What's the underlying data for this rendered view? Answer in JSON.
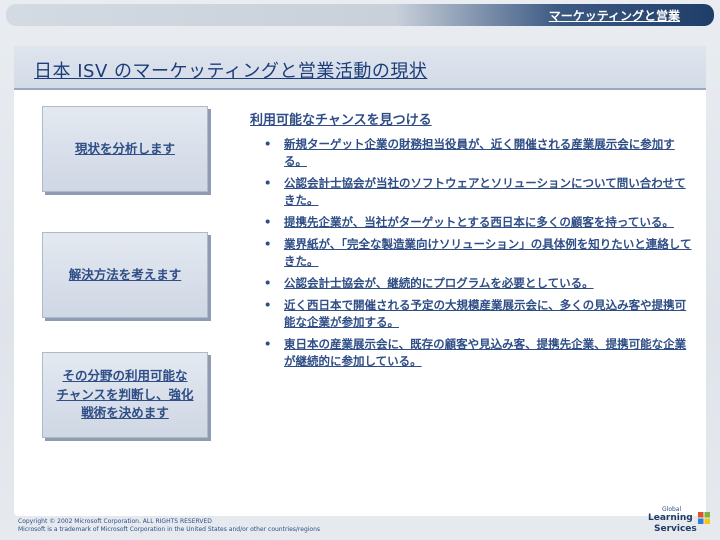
{
  "header": {
    "title": "マーケッティングと営業"
  },
  "page": {
    "title": "日本 ISV のマーケッティングと営業活動の現状"
  },
  "steps": [
    {
      "label": "現状を分析します"
    },
    {
      "label": "解決方法を考えます"
    },
    {
      "label": "その分野の利用可能な\nチャンスを判断し、強化\n戦術を決めます"
    }
  ],
  "section": {
    "heading": "利用可能なチャンスを見つける",
    "bullets": [
      "新規ターゲット企業の財務担当役員が、近く開催される産業展示会に参加する。",
      "公認会計士協会が当社のソフトウェアとソリューションについて問い合わせてきた。",
      "提携先企業が、当社がターゲットとする西日本に多くの顧客を持っている。",
      "業界紙が、「完全な製造業向けソリューション」の具体例を知りたいと連絡してきた。",
      "公認会計士協会が、継続的にプログラムを必要としている。",
      "近く西日本で開催される予定の大規模産業展示会に、多くの見込み客や提携可能な企業が参加する。",
      "東日本の産業展示会に、既存の顧客や見込み客、提携先企業、提携可能な企業が継続的に参加している。"
    ]
  },
  "footer": {
    "line1": "Copyright © 2002 Microsoft Corporation. ALL RIGHTS RESERVED",
    "line2": "Microsoft is a trademark of Microsoft Corporation in the United States and/or other countries/regions"
  },
  "logo": {
    "small": "Global",
    "line1": "Learning",
    "line2": "Services"
  },
  "colors": {
    "accent": "#2f4e86",
    "header_dark": "#1e3d68"
  }
}
